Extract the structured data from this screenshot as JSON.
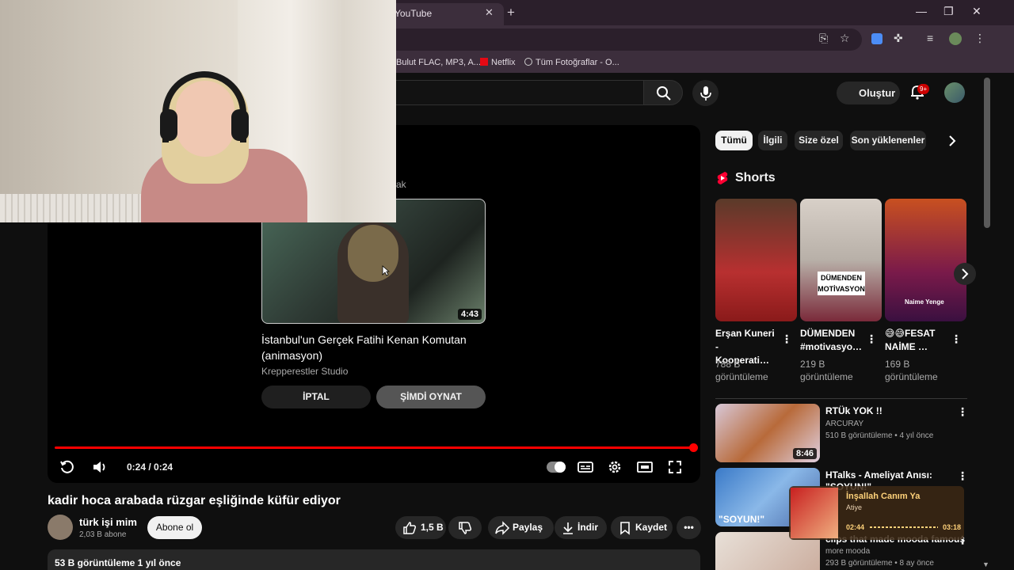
{
  "browser": {
    "tab_title": "YouTube",
    "bookmarks": [
      "Bulut FLAC, MP3, A...",
      "Netflix",
      "Tüm Fotoğraflar - O..."
    ]
  },
  "header": {
    "create_label": "Oluştur",
    "notifications_badge": "9+"
  },
  "player": {
    "upnext_label": "ak",
    "endcard": {
      "title": "İstanbul'un Gerçek Fatihi Kenan Komutan (animasyon)",
      "channel": "Krepperestler Studio",
      "duration": "4:43",
      "cancel_label": "İPTAL",
      "play_label": "ŞİMDİ OYNAT"
    },
    "time": "0:24 / 0:24",
    "progress": 1.0
  },
  "video": {
    "title": "kadir hoca arabada rüzgar eşliğinde küfür ediyor",
    "channel_name": "türk işi mim",
    "subscribers": "2,03 B abone",
    "subscribe_label": "Abone ol",
    "likes": "1,5 B",
    "share_label": "Paylaş",
    "download_label": "İndir",
    "save_label": "Kaydet",
    "description_stats": "53 B görüntüleme  1 yıl önce"
  },
  "sidebar": {
    "chips": [
      "Tümü",
      "İlgili",
      "Size özel",
      "Son yüklenenler"
    ],
    "shorts_title": "Shorts",
    "shorts": [
      {
        "title": "Erşan Kuneri - Kooperati…",
        "views": "788 B görüntüleme"
      },
      {
        "title": "DÜMENDEN #motivasyo…",
        "views": "219 B görüntüleme",
        "thumb_text": "DÜMENDEN MOTİVASYON"
      },
      {
        "title": "😅😅FESAT NAİME …",
        "views": "169 B görüntüleme",
        "thumb_text": "Naime Yenge"
      }
    ],
    "recommendations": [
      {
        "title": "RTÜk YOK !!",
        "channel": "ARCURAY",
        "meta": "510 B görüntüleme • 4 yıl önce",
        "duration": "8:46"
      },
      {
        "title": "HTalks - Ameliyat Anısı:",
        "title2": "\"SOYUN!\"",
        "thumb_text": "\"SOYUN!\""
      },
      {
        "title": "clips that made mooda famous",
        "channel": "more mooda",
        "meta": "293 B görüntüleme • 8 ay önce"
      }
    ]
  },
  "music_widget": {
    "title": "İnşallah Canım Ya",
    "artist": "Atiye",
    "elapsed": "02:44",
    "total": "03:18"
  },
  "colors": {
    "accent": "#ff0000",
    "background": "#0f0f0f",
    "chip": "#272727"
  }
}
